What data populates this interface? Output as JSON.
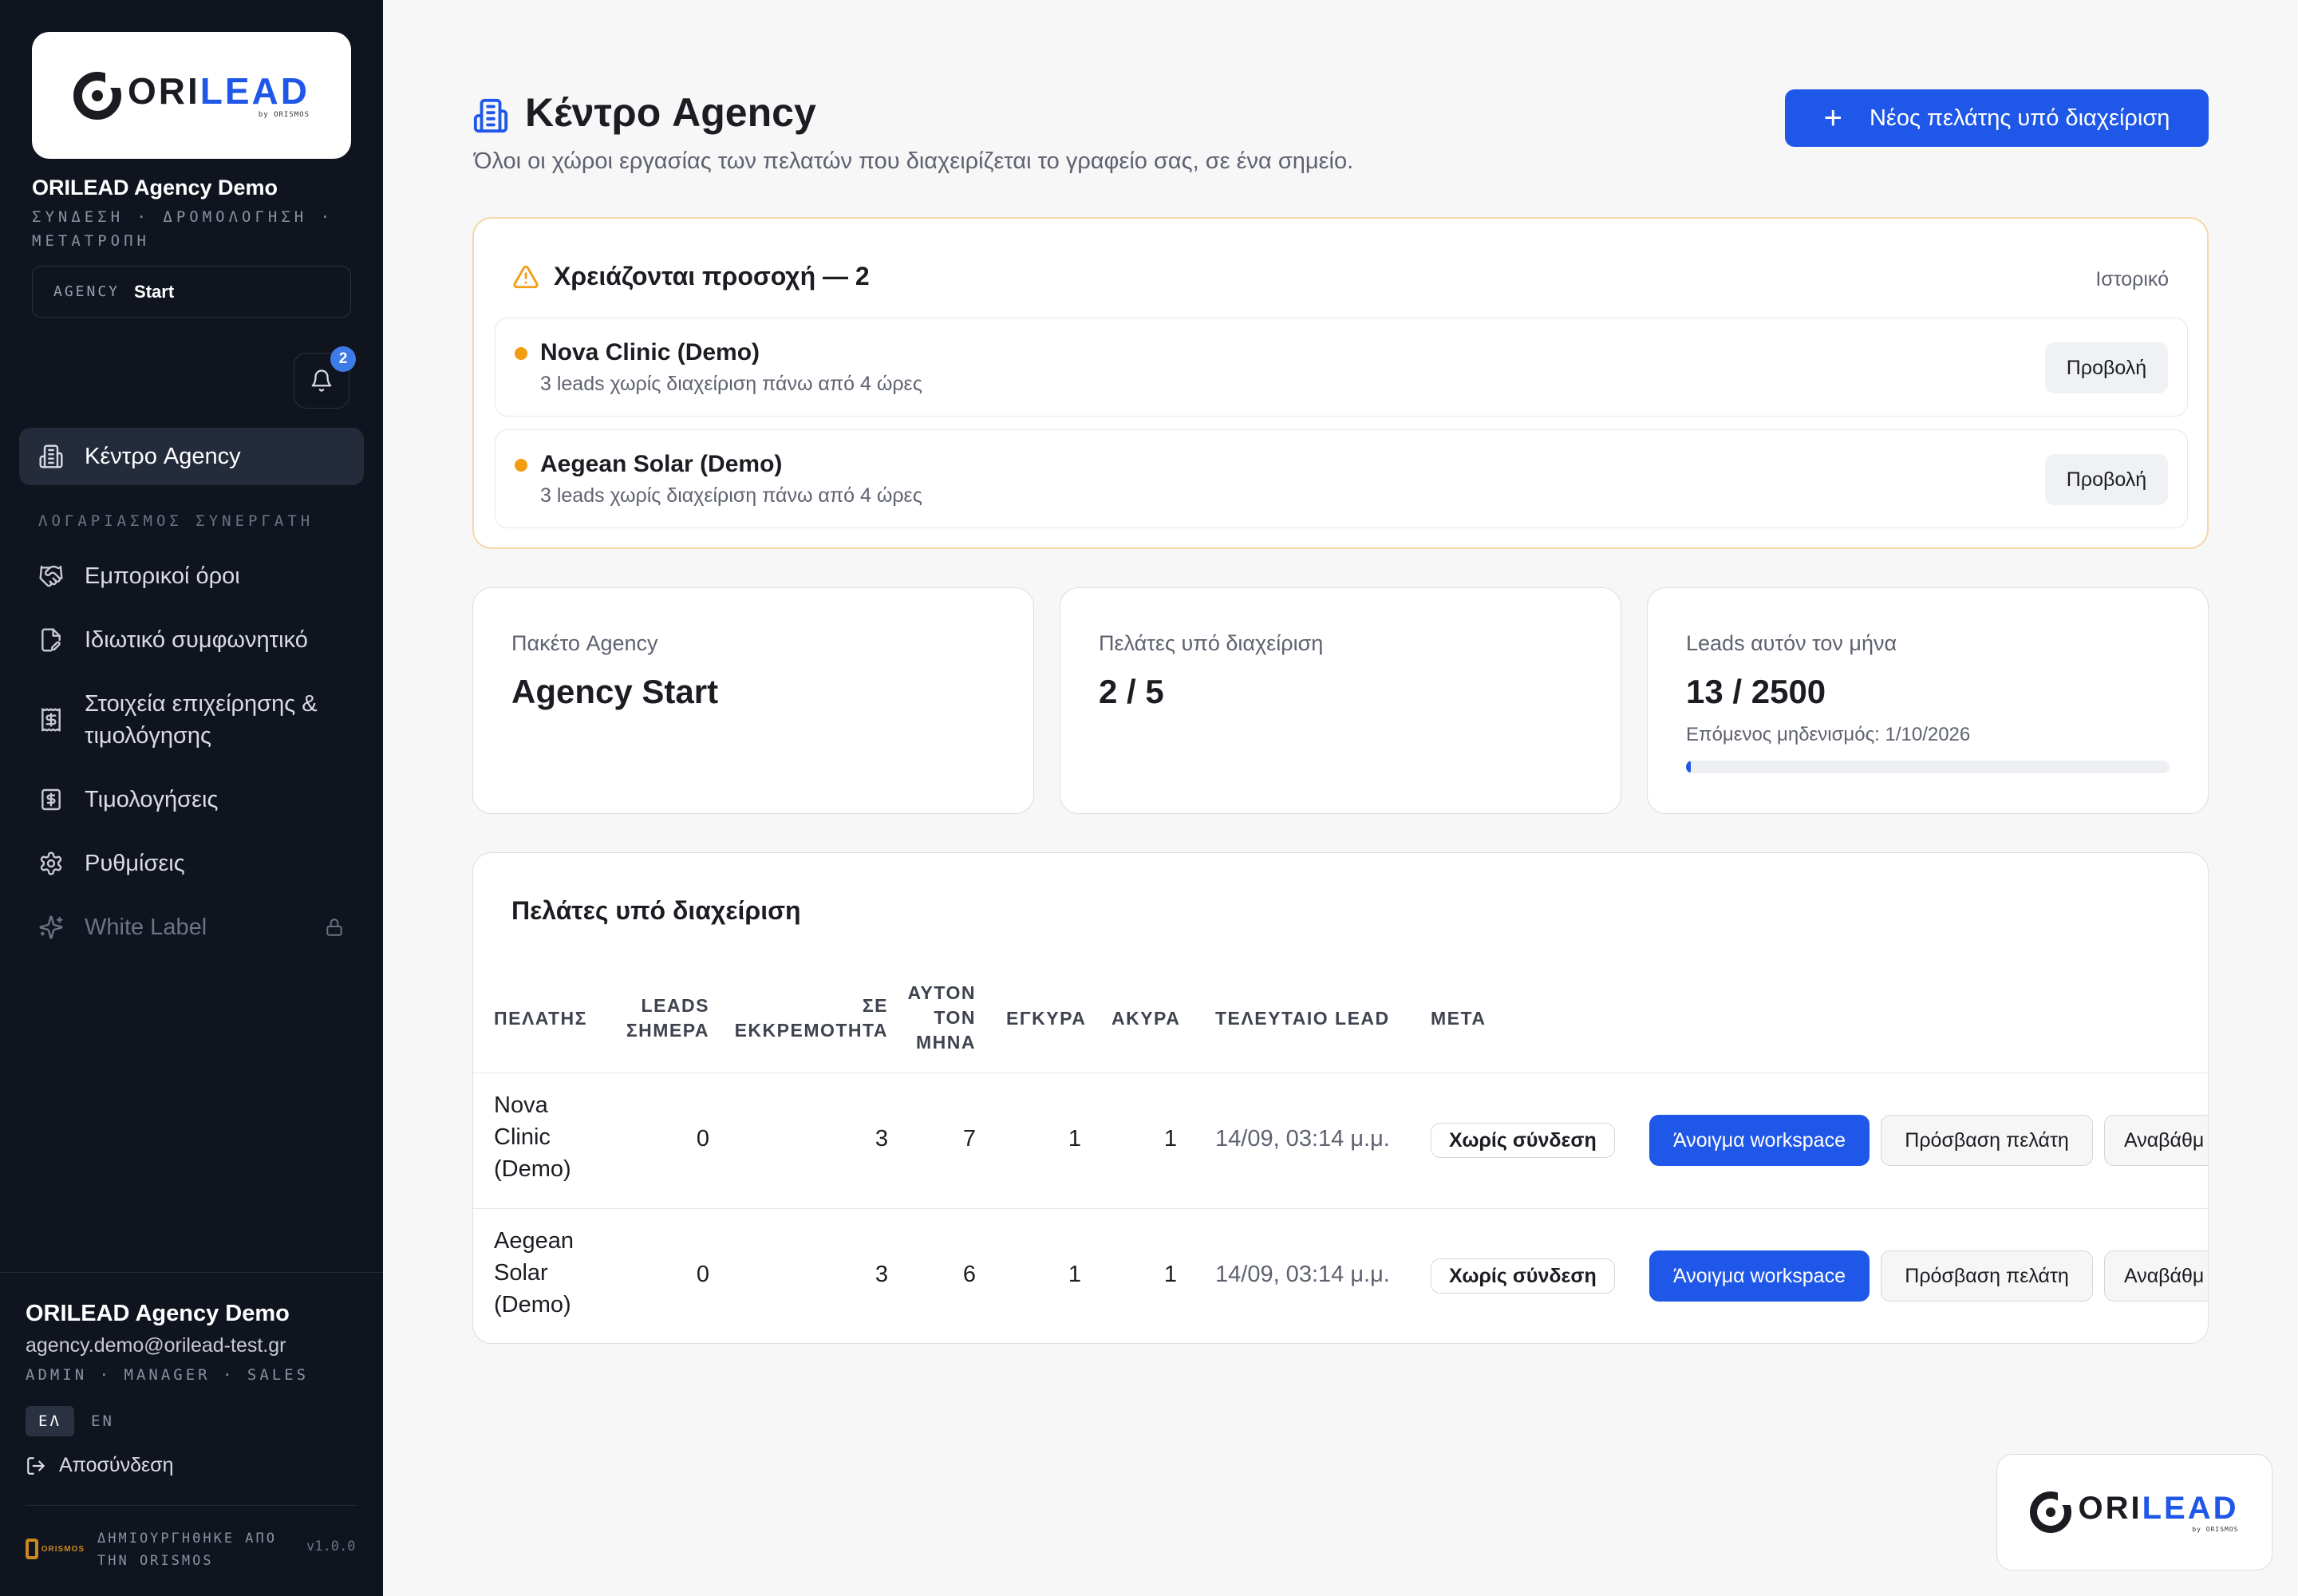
{
  "brand": {
    "logo_ori": "ORI",
    "logo_lead": "LEAD",
    "logo_by": "by ORISMOS",
    "accent": "#1f57e8"
  },
  "sidebar": {
    "org_name": "ORILEAD Agency Demo",
    "org_tagline": "ΣΥΝΔΕΣΗ · ΔΡΟΜΟΛΟΓΗΣΗ · ΜΕΤΑΤΡΟΠΗ",
    "plan_key": "AGENCY",
    "plan_value": "Start",
    "notifications_count": "2",
    "active_item": "Κέντρο Agency",
    "section_label": "ΛΟΓΑΡΙΑΣΜΟΣ ΣΥΝΕΡΓΑΤΗ",
    "items": [
      {
        "label": "Εμπορικοί όροι",
        "icon": "handshake-icon"
      },
      {
        "label": "Ιδιωτικό συμφωνητικό",
        "icon": "contract-icon"
      },
      {
        "label": "Στοιχεία επιχείρησης & τιμολόγησης",
        "icon": "receipt-icon"
      },
      {
        "label": "Τιμολογήσεις",
        "icon": "invoice-icon"
      },
      {
        "label": "Ρυθμίσεις",
        "icon": "gear-icon"
      },
      {
        "label": "White Label",
        "icon": "sparkles-icon",
        "locked": true
      }
    ],
    "user": {
      "name": "ORILEAD Agency Demo",
      "email": "agency.demo@orilead-test.gr",
      "roles": "ADMIN · MANAGER · SALES"
    },
    "lang_active": "ΕΛ",
    "lang_other": "EN",
    "logout_label": "Αποσύνδεση",
    "made_by": "ΔΗΜΙΟΥΡΓΗΘΗΚΕ ΑΠΟ ΤΗΝ ORISMOS",
    "made_logo_text": "ORISMOS",
    "version": "v1.0.0"
  },
  "header": {
    "title": "Κέντρο Agency",
    "subtitle": "Όλοι οι χώροι εργασίας των πελατών που διαχειρίζεται το γραφείο σας, σε ένα σημείο.",
    "new_client_button": "Νέος πελάτης υπό διαχείριση"
  },
  "attention": {
    "title": "Χρειάζονται προσοχή — 2",
    "history_link": "Ιστορικό",
    "rows": [
      {
        "name": "Nova Clinic (Demo)",
        "desc": "3 leads χωρίς διαχείριση πάνω από 4 ώρες",
        "button": "Προβολή"
      },
      {
        "name": "Aegean Solar (Demo)",
        "desc": "3 leads χωρίς διαχείριση πάνω από 4 ώρες",
        "button": "Προβολή"
      }
    ],
    "dot_color": "#f39c12"
  },
  "stats": [
    {
      "label": "Πακέτο Agency",
      "value": "Agency Start"
    },
    {
      "label": "Πελάτες υπό διαχείριση",
      "value": "2 / 5"
    },
    {
      "label": "Leads αυτόν τον μήνα",
      "value": "13 / 2500",
      "note": "Επόμενος μηδενισμός: 1/10/2026",
      "progress": 0.0052
    }
  ],
  "clients_table": {
    "title": "Πελάτες υπό διαχείριση",
    "columns": [
      "ΠΕΛΑΤΗΣ",
      "LEADS ΣΗΜΕΡΑ",
      "ΣΕ ΕΚΚΡΕΜΟΤΗΤΑ",
      "ΑΥΤΟΝ ΤΟΝ ΜΗΝΑ",
      "ΕΓΚΥΡΑ",
      "ΑΚΥΡΑ",
      "ΤΕΛΕΥΤΑΙΟ LEAD",
      "ΜΕΤΑ"
    ],
    "rows": [
      {
        "client": "Nova Clinic (Demo)",
        "today": "0",
        "pending": "3",
        "month": "7",
        "valid": "1",
        "invalid": "1",
        "last_lead": "14/09, 03:14 μ.μ.",
        "status": "Χωρίς σύνδεση",
        "open": "Άνοιγμα workspace",
        "access": "Πρόσβαση πελάτη",
        "upgrade": "Αναβάθμ"
      },
      {
        "client": "Aegean Solar (Demo)",
        "today": "0",
        "pending": "3",
        "month": "6",
        "valid": "1",
        "invalid": "1",
        "last_lead": "14/09, 03:14 μ.μ.",
        "status": "Χωρίς σύνδεση",
        "open": "Άνοιγμα workspace",
        "access": "Πρόσβαση πελάτη",
        "upgrade": "Αναβάθμ"
      }
    ]
  }
}
